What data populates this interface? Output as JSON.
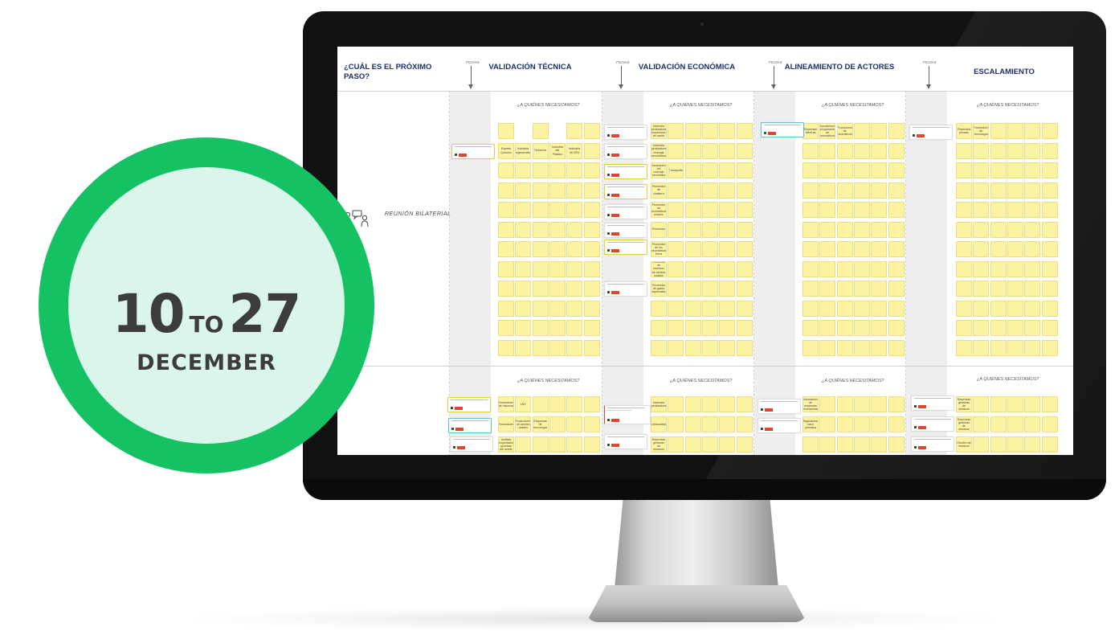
{
  "board": {
    "main_question": "¿CUÁL ES EL PRÓXIMO PASO?",
    "row_label": "REUNIÓN BILATERIAL",
    "fichas_label": "FICHAS",
    "who_label": "¿A QUIÉNES NECESITAMOS?",
    "columns": [
      {
        "title": "VALIDACIÓN TÉCNICA"
      },
      {
        "title": "VALIDACIÓN ECONÓMICA"
      },
      {
        "title": "ALINEAMIENTO DE ACTORES"
      },
      {
        "title": "ESCALAMIENTO"
      }
    ],
    "stickies": {
      "tecnica_1": "Experto Químico",
      "tecnica_2": "Industria regenerativa",
      "tecnica_3": "Refinería",
      "tecnica_4": "Industria del Plástico",
      "tecnica_5": "Industria de NFU",
      "economica_1": "Industria pirolizadora recuperadora de aceite",
      "economica_2": "Industria pirolizadora reciclaje neumáticos",
      "economica_3": "Asociación del reciclaje neumático",
      "economica_4": "Transporte",
      "economica_5": "Proveedor de chatarra",
      "economica_6": "Proveedor de neumáticos usados",
      "economica_7": "Proveedor",
      "economica_8": "Proveedor de los neumáticos fuera",
      "economica_9": "Proveedor de residuos de aceites usados",
      "economica_10": "Proveedor de gases especiales",
      "actores_1": "Empresas Mineras",
      "actores_2": "Asociaciones recuperación de neumáticos",
      "actores_3": "Productores de neumáticos",
      "escala_1": "Financista privado",
      "escala_2": "Proveedores de tecnología",
      "tecnica_6": "Proveedores de insumos",
      "tecnica_7": "LNV",
      "tecnica_8": "Proveedores",
      "tecnica_9": "Productores de aceites usados",
      "tecnica_10": "Empresas de tecnología",
      "tecnica_11": "Análisis propiedades químicas del aceite",
      "economica_11": "Inversionistas",
      "economica_12": "Industria pirolizadora",
      "economica_13": "Empresas gestoras de residuos",
      "actores_4": "Asociación de empresas recicladoras",
      "actores_5": "Reguladores para permisos",
      "escala_3": "Empresas gestoras de residuos",
      "escala_4": "Empresas gestoras de residuos",
      "escala_5": "Gestión de residuos"
    }
  },
  "badge": {
    "start_day": "10",
    "connector": "TO",
    "end_day": "27",
    "month": "DECEMBER"
  },
  "colors": {
    "badge_ring": "#14c264",
    "badge_fill": "#daf5ea",
    "title_navy": "#1d2f6b",
    "sticky": "#fbf3a1",
    "tag_red": "#e0452c"
  }
}
